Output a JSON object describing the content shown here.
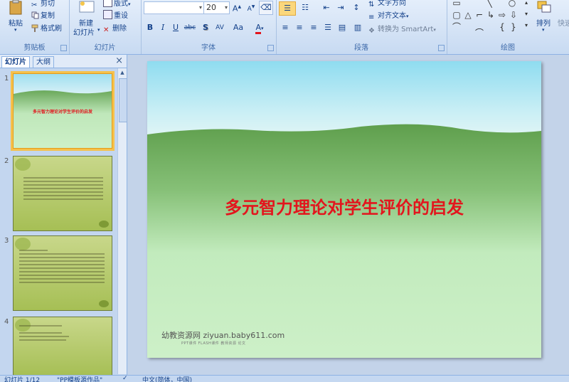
{
  "ribbon": {
    "clipboard": {
      "group_label": "剪贴板",
      "paste": "粘贴",
      "cut": "剪切",
      "copy": "复制",
      "format_painter": "格式刷"
    },
    "slides": {
      "group_label": "幻灯片",
      "new_slide_line1": "新建",
      "new_slide_line2": "幻灯片",
      "layout": "版式",
      "reset": "重设",
      "delete": "删除"
    },
    "font": {
      "group_label": "字体",
      "font_name": "",
      "font_size": "20",
      "grow": "A",
      "shrink": "A",
      "bold": "B",
      "italic": "I",
      "underline": "U",
      "strike": "abc",
      "shadow": "S",
      "spacing": "AV",
      "case": "Aa",
      "color": "A"
    },
    "paragraph": {
      "group_label": "段落",
      "text_direction": "文字方向",
      "align_text": "对齐文本",
      "smartart": "转换为 SmartArt"
    },
    "drawing": {
      "group_label": "绘图",
      "arrange": "排列",
      "quick_styles": "快速"
    }
  },
  "panel": {
    "tab_slides": "幻灯片",
    "tab_outline": "大纲",
    "close": "×",
    "thumbnails": [
      {
        "number": "1",
        "title": "多元智力理论对学生评价的启发"
      },
      {
        "number": "2"
      },
      {
        "number": "3"
      },
      {
        "number": "4"
      }
    ]
  },
  "slide": {
    "title": "多元智力理论对学生评价的启发",
    "footer": "幼教资源网 ziyuan.baby611.com",
    "footer_sub": "PPT课件   FLASH课件   教师资源   论文"
  },
  "status": {
    "slide_counter": "幻灯片 1/12",
    "theme": "\"PP模板源作品\"",
    "language": "中文(简体，中国)"
  },
  "colors": {
    "title_red": "#e3151d",
    "ribbon_blue": "#15428b",
    "active_thumb": "#f6c14b"
  }
}
